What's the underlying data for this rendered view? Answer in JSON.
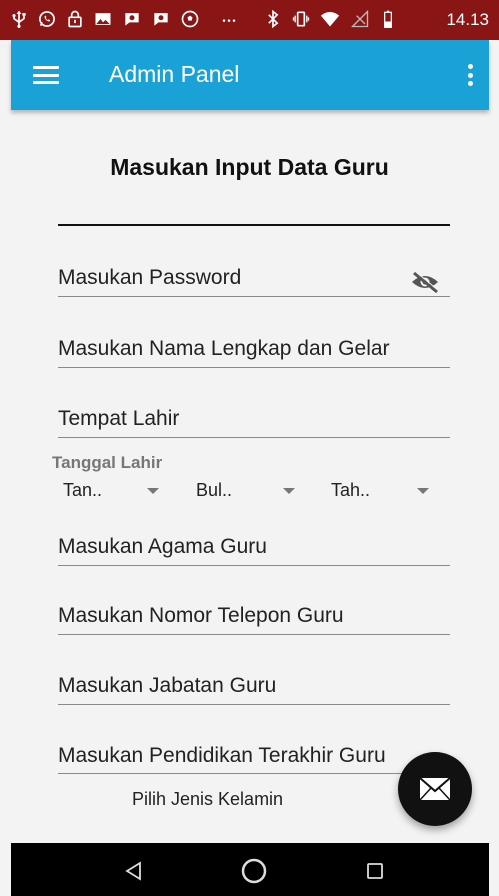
{
  "status_bar": {
    "time": "14.13",
    "icons": [
      "usb-icon",
      "whatsapp-icon",
      "lock-icon",
      "image-icon",
      "chat-icon",
      "chat-icon",
      "soccer-icon",
      "more-notifications-icon",
      "bluetooth-icon",
      "vibrate-icon",
      "wifi-icon",
      "no-signal-icon",
      "battery-icon"
    ]
  },
  "app_bar": {
    "title": "Admin Panel",
    "background": "#1aa2d6"
  },
  "form": {
    "title": "Masukan Input Data Guru",
    "fields": {
      "username": "",
      "password": "Masukan Password",
      "full_name": "Masukan Nama Lengkap dan Gelar",
      "birth_place": "Tempat Lahir",
      "religion": "Masukan Agama Guru",
      "phone": "Masukan Nomor Telepon Guru",
      "position": "Masukan Jabatan Guru",
      "education": "Masukan Pendidikan Terakhir Guru"
    },
    "dob": {
      "label": "Tanggal Lahir",
      "day": "Tan..",
      "month": "Bul..",
      "year": "Tah.."
    },
    "gender_label": "Pilih Jenis Kelamin"
  },
  "colors": {
    "status_bar": "#8a1515",
    "accent": "#1aa2d6",
    "fab": "#111111"
  }
}
